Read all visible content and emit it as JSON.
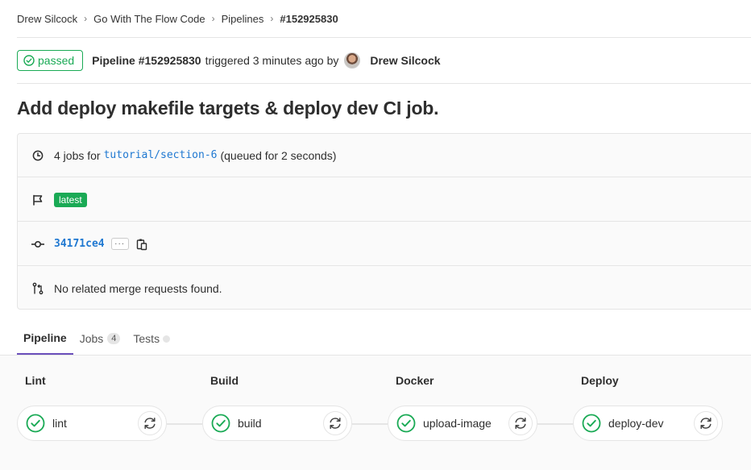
{
  "breadcrumb": {
    "items": [
      "Drew Silcock",
      "Go With The Flow Code",
      "Pipelines",
      "#152925830"
    ]
  },
  "header": {
    "status": "passed",
    "pipeline_label": "Pipeline #152925830",
    "triggered_text": "triggered 3 minutes ago by",
    "author": "Drew Silcock"
  },
  "commit_title": "Add deploy makefile targets & deploy dev CI job.",
  "info": {
    "jobs_prefix": "4 jobs for",
    "branch": "tutorial/section-6",
    "jobs_suffix": "(queued for 2 seconds)",
    "latest_badge": "latest",
    "sha": "34171ce4",
    "ellipsis": "···",
    "merge_requests": "No related merge requests found."
  },
  "tabs": {
    "pipeline": "Pipeline",
    "jobs": "Jobs",
    "jobs_count": "4",
    "tests": "Tests"
  },
  "stages": [
    {
      "title": "Lint",
      "job": "lint",
      "status": "passed"
    },
    {
      "title": "Build",
      "job": "build",
      "status": "passed"
    },
    {
      "title": "Docker",
      "job": "upload-image",
      "status": "passed"
    },
    {
      "title": "Deploy",
      "job": "deploy-dev",
      "status": "passed"
    }
  ],
  "colors": {
    "success": "#1aaa55",
    "link": "#1f78d1",
    "active_tab": "#6b4fbb"
  }
}
